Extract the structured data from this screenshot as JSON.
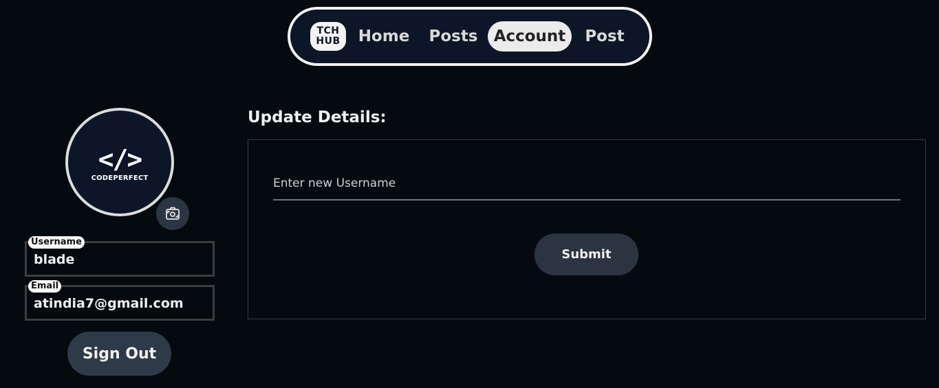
{
  "nav": {
    "logo_line1": "TCH",
    "logo_line2": "HUB",
    "items": [
      {
        "label": "Home"
      },
      {
        "label": "Posts"
      },
      {
        "label": "Account"
      },
      {
        "label": "Post"
      }
    ],
    "active": "Account"
  },
  "profile": {
    "avatar_code": "</>",
    "avatar_brand": "CODEPERFECT",
    "change_photo_icon": "change-photo-icon",
    "username_label": "Username",
    "username_value": "blade",
    "email_label": "Email",
    "email_value": "atindia7@gmail.com",
    "signout_label": "Sign Out"
  },
  "update": {
    "title": "Update Details:",
    "username_placeholder": "Enter new Username",
    "submit_label": "Submit"
  },
  "colors": {
    "background": "#050a0f",
    "nav_bg": "#0c1627",
    "active_tab_bg": "#ebebeb",
    "button_bg": "#2b3440"
  }
}
